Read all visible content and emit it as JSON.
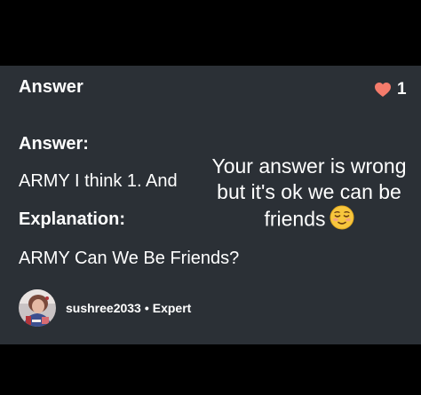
{
  "card": {
    "title": "Answer",
    "like_count": "1",
    "heart_color": "#f47b6b"
  },
  "answer": {
    "label": "Answer:",
    "text": "ARMY I think 1. And"
  },
  "overlay": {
    "line1": "Your answer is wrong",
    "line2": "but it's ok we can be",
    "line3": "friends"
  },
  "explanation": {
    "label": "Explanation:",
    "text": "ARMY Can We Be Friends?"
  },
  "author": {
    "username": "sushree2033",
    "separator": "•",
    "rank": "Expert"
  },
  "icons": {
    "like": "heart-icon",
    "emoji": "relieved-face-emoji"
  }
}
